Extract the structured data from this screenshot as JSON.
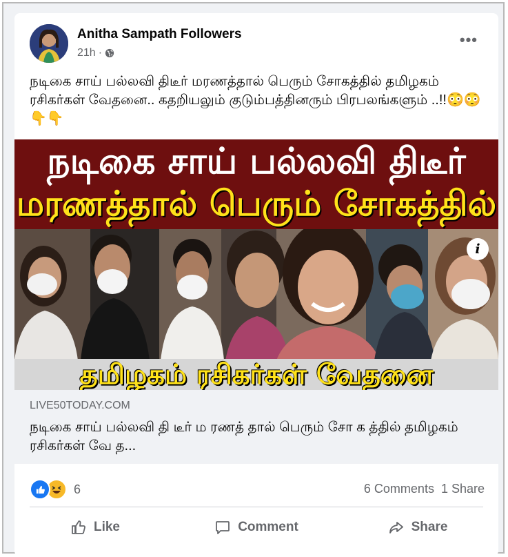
{
  "post": {
    "author": "Anitha Sampath Followers",
    "time": "21h",
    "separator": "·",
    "privacy_icon": "globe-icon",
    "more_icon": "ellipsis-icon",
    "caption": "நடிகை சாய் பல்லவி திடீர் மரணத்தால் பெரும் சோகத்தில் தமிழகம் ரசிகர்கள் வேதனை.. கதறியலும் குடும்பத்தினரும் பிரபலங்களும் ..!!😳😳👇👇"
  },
  "media": {
    "headline_line1": "நடிகை சாய் பல்லவி திடீர்",
    "headline_line2": "மரணத்தால் பெரும் சோகத்தில்",
    "headline_line3": "தமிழகம் ரசிகர்கள் வேதனை",
    "info_label": "i",
    "colors": {
      "band": "#6e0f0f",
      "yellow": "#ffe21a"
    }
  },
  "link": {
    "domain": "LIVE50TODAY.COM",
    "title": "நடிகை சாய் பல்லவி தி டீர் ம ரணத் தால் பெரும் சோ க த்தில் தமிழகம் ரசிகர்கள் வே த..."
  },
  "reactions": {
    "count": "6",
    "comments": "6 Comments",
    "shares": "1 Share"
  },
  "actions": {
    "like": "Like",
    "comment": "Comment",
    "share": "Share"
  }
}
